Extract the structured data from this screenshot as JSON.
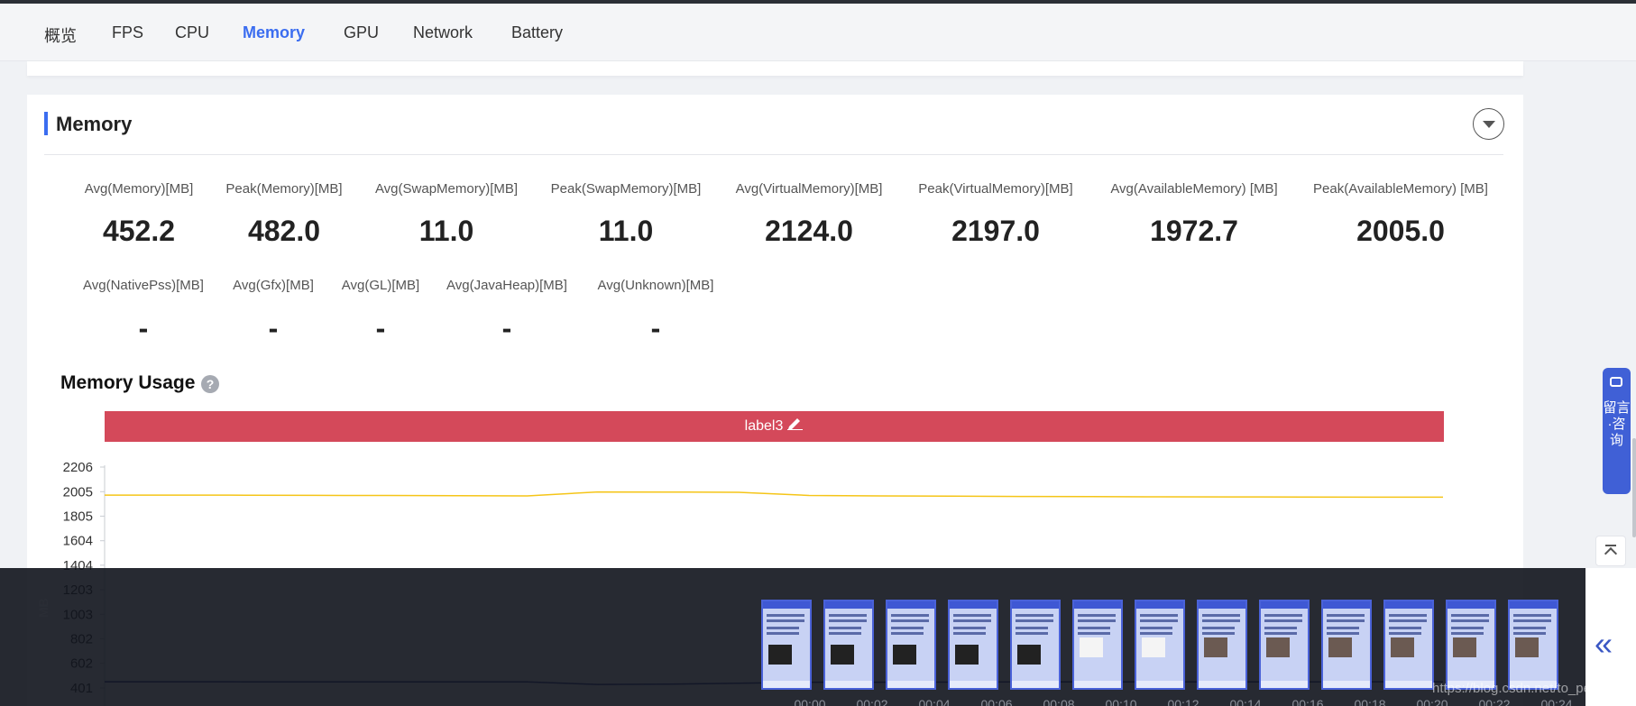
{
  "tabs": [
    {
      "label": "概览",
      "active": false
    },
    {
      "label": "FPS",
      "active": false
    },
    {
      "label": "CPU",
      "active": false
    },
    {
      "label": "Memory",
      "active": true
    },
    {
      "label": "GPU",
      "active": false
    },
    {
      "label": "Network",
      "active": false
    },
    {
      "label": "Battery",
      "active": false
    }
  ],
  "section": {
    "title": "Memory"
  },
  "metrics_row1": [
    {
      "label": "Avg(Memory)[MB]",
      "value": "452.2"
    },
    {
      "label": "Peak(Memory)[MB]",
      "value": "482.0"
    },
    {
      "label": "Avg(SwapMemory)[MB]",
      "value": "11.0"
    },
    {
      "label": "Peak(SwapMemory)[MB]",
      "value": "11.0"
    },
    {
      "label": "Avg(VirtualMemory)[MB]",
      "value": "2124.0"
    },
    {
      "label": "Peak(VirtualMemory)[MB]",
      "value": "2197.0"
    },
    {
      "label": "Avg(AvailableMemory) [MB]",
      "value": "1972.7"
    },
    {
      "label": "Peak(AvailableMemory) [MB]",
      "value": "2005.0"
    }
  ],
  "metrics_row2": [
    {
      "label": "Avg(NativePss)[MB]",
      "value": "-"
    },
    {
      "label": "Avg(Gfx)[MB]",
      "value": "-"
    },
    {
      "label": "Avg(GL)[MB]",
      "value": "-"
    },
    {
      "label": "Avg(JavaHeap)[MB]",
      "value": "-"
    },
    {
      "label": "Avg(Unknown)[MB]",
      "value": "-"
    }
  ],
  "usage": {
    "title": "Memory Usage",
    "help_icon": "?"
  },
  "label_bar": {
    "text": "label3",
    "icon": "pencil-icon",
    "color": "#d4495a"
  },
  "chart_data": {
    "type": "line",
    "ylabel": "MB",
    "yticks": [
      "2206",
      "2005",
      "1805",
      "1604",
      "1404",
      "1203",
      "1003",
      "802",
      "602",
      "401"
    ],
    "ylim": [
      401,
      2206
    ],
    "x": [
      "00:00",
      "00:02",
      "00:04",
      "00:06",
      "00:08",
      "00:10",
      "00:12",
      "00:14",
      "00:16",
      "00:18",
      "00:20",
      "00:22",
      "00:24"
    ],
    "series": [
      {
        "color": "#f5c518",
        "values": [
          1977,
          1977,
          1976,
          1975,
          1974,
          1972,
          1970,
          2003,
          2002,
          2000,
          1974,
          1970,
          1968,
          1966,
          1964,
          1963,
          1962,
          1961,
          1960,
          1960
        ]
      },
      {
        "color": "#2d3a8c",
        "values": [
          452,
          452,
          451,
          451,
          451,
          450,
          450,
          430,
          432,
          440,
          448,
          448,
          449,
          450,
          450,
          451,
          451,
          451,
          452,
          452
        ]
      }
    ]
  },
  "scrubber": {
    "times": [
      "00:00",
      "00:02",
      "00:04",
      "00:06",
      "00:08",
      "00:10",
      "00:12",
      "00:14",
      "00:16",
      "00:18",
      "00:20",
      "00:22",
      "00:24"
    ]
  },
  "side_widget": {
    "text": "留言·咨询",
    "icon": "chat-icon",
    "color": "#4060d6"
  },
  "back_to_top": {
    "icon": "back-to-top-icon"
  },
  "collapse": {
    "icon": "chevron-down-icon"
  },
  "expand": {
    "icon": "double-chevron-left-icon",
    "glyph": "«"
  },
  "watermark": "https://blog.csdn.net/to_perfect"
}
